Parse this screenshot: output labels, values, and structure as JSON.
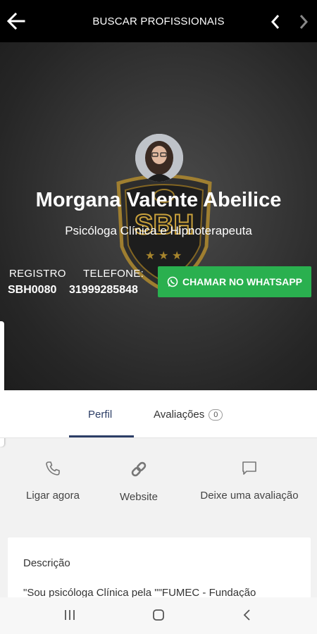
{
  "topbar": {
    "title": "BUSCAR PROFISSIONAIS",
    "back_icon": "arrow-left-icon",
    "prev_icon": "chevron-left-icon",
    "next_icon": "chevron-right-icon"
  },
  "profile": {
    "name": "Morgana Valente Abeilice",
    "subtitle": "Psicóloga Clínica e Hipnoterapeuta",
    "badge_text": "SBH",
    "registro_label": "REGISTRO",
    "registro_value": "SBH0080",
    "telefone_label": "TELEFONE:",
    "telefone_value": "31999285848",
    "whatsapp_button": "CHAMAR NO WHATSAPP"
  },
  "tabs": [
    {
      "label": "Perfil",
      "active": true
    },
    {
      "label": "Avaliações",
      "count": "0",
      "active": false
    }
  ],
  "actions": [
    {
      "label": "Ligar agora",
      "icon": "phone-icon"
    },
    {
      "label": "Website",
      "icon": "link-icon"
    },
    {
      "label": "Deixe uma avaliação",
      "icon": "chat-icon"
    }
  ],
  "description": {
    "title": "Descrição",
    "text": "\"Sou psicóloga Clínica pela \"\"FUMEC - Fundação"
  },
  "colors": {
    "whatsapp_green": "#2ab04f",
    "active_tab": "#2c3e66",
    "topbar": "#000000"
  }
}
